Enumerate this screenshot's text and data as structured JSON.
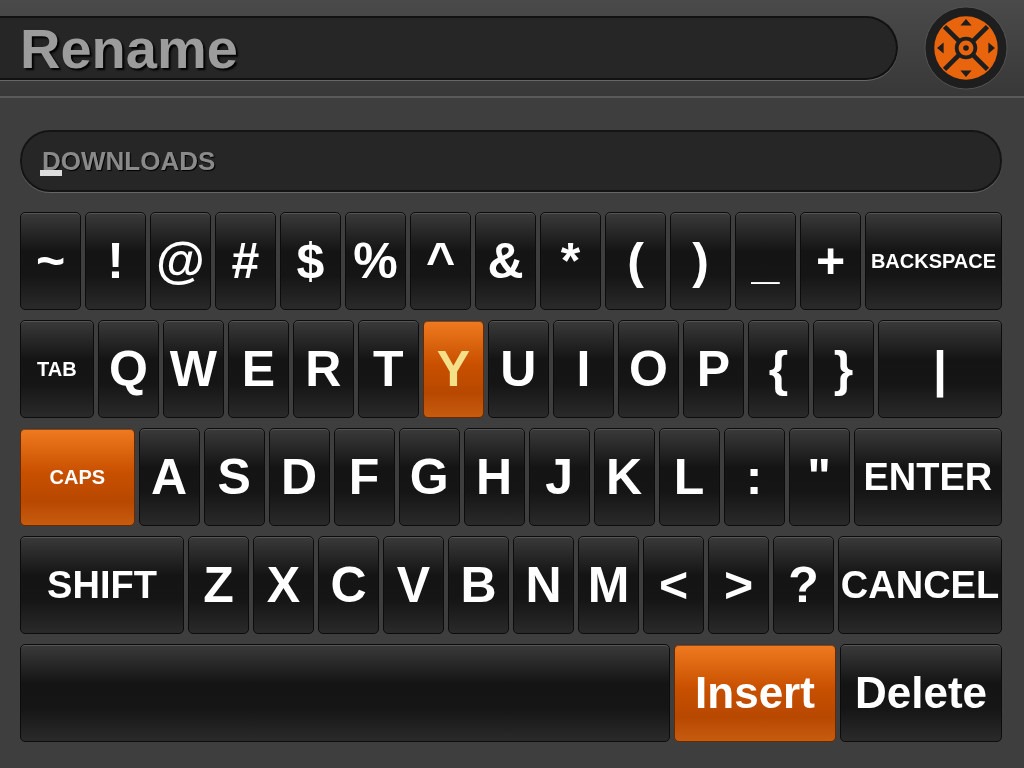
{
  "title": "Rename",
  "input": {
    "value": "DOWNLOADS"
  },
  "rows": [
    [
      {
        "label": "~",
        "kind": "char",
        "selected": false
      },
      {
        "label": "!",
        "kind": "char",
        "selected": false
      },
      {
        "label": "@",
        "kind": "char",
        "selected": false
      },
      {
        "label": "#",
        "kind": "char",
        "selected": false
      },
      {
        "label": "$",
        "kind": "char",
        "selected": false
      },
      {
        "label": "%",
        "kind": "char",
        "selected": false
      },
      {
        "label": "^",
        "kind": "char",
        "selected": false
      },
      {
        "label": "&",
        "kind": "char",
        "selected": false
      },
      {
        "label": "*",
        "kind": "char",
        "selected": false
      },
      {
        "label": "(",
        "kind": "char",
        "selected": false
      },
      {
        "label": ")",
        "kind": "char",
        "selected": false
      },
      {
        "label": "_",
        "kind": "char",
        "selected": false
      },
      {
        "label": "+",
        "kind": "char",
        "selected": false
      },
      {
        "label": "BACKSPACE",
        "kind": "function",
        "selected": false
      }
    ],
    [
      {
        "label": "TAB",
        "kind": "function",
        "selected": false
      },
      {
        "label": "Q",
        "kind": "char",
        "selected": false
      },
      {
        "label": "W",
        "kind": "char",
        "selected": false
      },
      {
        "label": "E",
        "kind": "char",
        "selected": false
      },
      {
        "label": "R",
        "kind": "char",
        "selected": false
      },
      {
        "label": "T",
        "kind": "char",
        "selected": false
      },
      {
        "label": "Y",
        "kind": "char",
        "selected": true
      },
      {
        "label": "U",
        "kind": "char",
        "selected": false
      },
      {
        "label": "I",
        "kind": "char",
        "selected": false
      },
      {
        "label": "O",
        "kind": "char",
        "selected": false
      },
      {
        "label": "P",
        "kind": "char",
        "selected": false
      },
      {
        "label": "{",
        "kind": "char",
        "selected": false
      },
      {
        "label": "}",
        "kind": "char",
        "selected": false
      },
      {
        "label": "|",
        "kind": "wide",
        "selected": false
      }
    ],
    [
      {
        "label": "CAPS",
        "kind": "function",
        "selected": true
      },
      {
        "label": "A",
        "kind": "char",
        "selected": false
      },
      {
        "label": "S",
        "kind": "char",
        "selected": false
      },
      {
        "label": "D",
        "kind": "char",
        "selected": false
      },
      {
        "label": "F",
        "kind": "char",
        "selected": false
      },
      {
        "label": "G",
        "kind": "char",
        "selected": false
      },
      {
        "label": "H",
        "kind": "char",
        "selected": false
      },
      {
        "label": "J",
        "kind": "char",
        "selected": false
      },
      {
        "label": "K",
        "kind": "char",
        "selected": false
      },
      {
        "label": "L",
        "kind": "char",
        "selected": false
      },
      {
        "label": ":",
        "kind": "char",
        "selected": false
      },
      {
        "label": "\"",
        "kind": "char",
        "selected": false
      },
      {
        "label": "ENTER",
        "kind": "word",
        "selected": false
      }
    ],
    [
      {
        "label": "SHIFT",
        "kind": "word",
        "selected": false
      },
      {
        "label": "Z",
        "kind": "char",
        "selected": false
      },
      {
        "label": "X",
        "kind": "char",
        "selected": false
      },
      {
        "label": "C",
        "kind": "char",
        "selected": false
      },
      {
        "label": "V",
        "kind": "char",
        "selected": false
      },
      {
        "label": "B",
        "kind": "char",
        "selected": false
      },
      {
        "label": "N",
        "kind": "char",
        "selected": false
      },
      {
        "label": "M",
        "kind": "char",
        "selected": false
      },
      {
        "label": "<",
        "kind": "char",
        "selected": false
      },
      {
        "label": ">",
        "kind": "char",
        "selected": false
      },
      {
        "label": "?",
        "kind": "char",
        "selected": false
      },
      {
        "label": "CANCEL",
        "kind": "word",
        "selected": false
      }
    ],
    [
      {
        "kind": "space",
        "selected": false
      },
      {
        "label": "Insert",
        "kind": "action",
        "selected": true
      },
      {
        "label": "Delete",
        "kind": "action",
        "selected": false
      }
    ]
  ]
}
